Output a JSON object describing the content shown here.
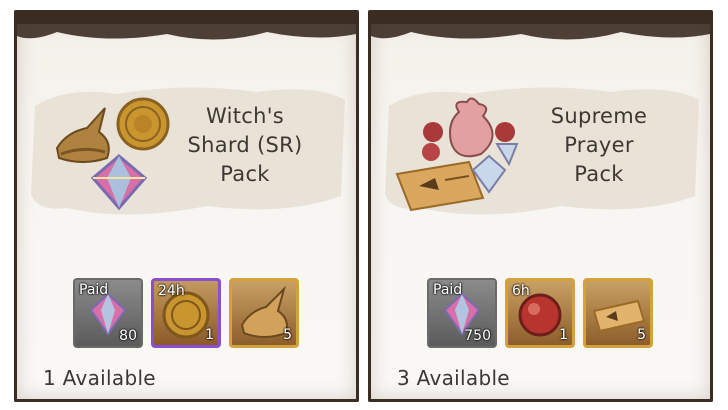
{
  "packs": [
    {
      "title": "Witch's\nShard (SR)\nPack",
      "available": "1 Available",
      "items": [
        {
          "icon": "prism-crystal-icon",
          "tag": "Paid",
          "qty": "80"
        },
        {
          "icon": "gold-coin-icon",
          "tag": "24h",
          "qty": "1"
        },
        {
          "icon": "witch-hat-icon",
          "tag": "",
          "qty": "5"
        }
      ]
    },
    {
      "title": "Supreme\nPrayer\nPack",
      "available": "3 Available",
      "items": [
        {
          "icon": "prism-crystal-icon",
          "tag": "Paid",
          "qty": "750"
        },
        {
          "icon": "red-orb-icon",
          "tag": "6h",
          "qty": "1"
        },
        {
          "icon": "prayer-ticket-icon",
          "tag": "",
          "qty": "5"
        }
      ]
    }
  ]
}
